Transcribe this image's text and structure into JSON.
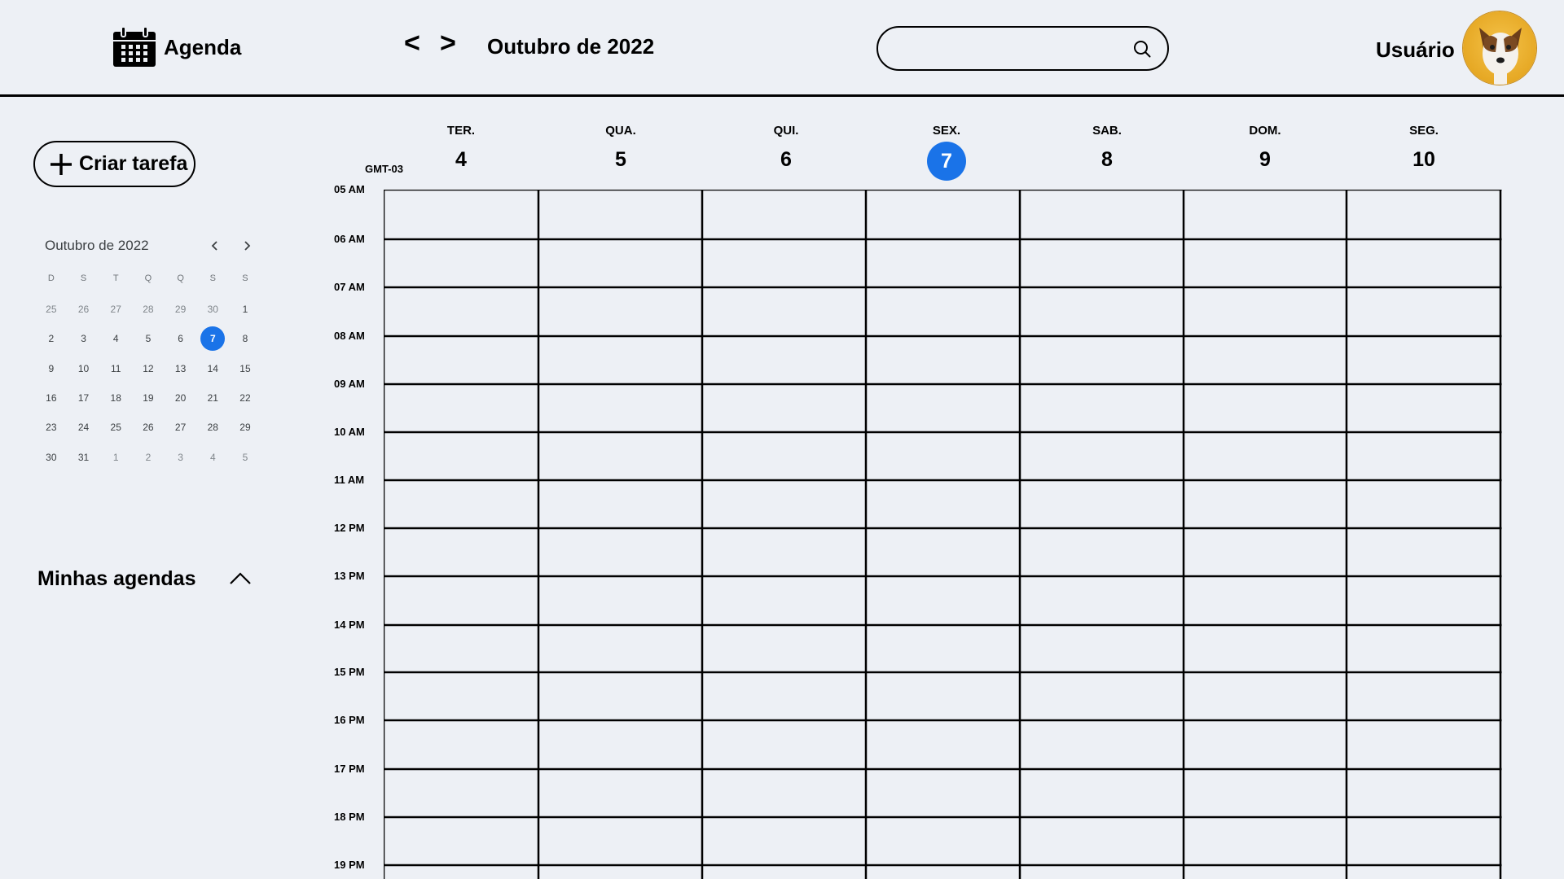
{
  "header": {
    "app_title": "Agenda",
    "prev_label": "<",
    "next_label": ">",
    "current_month": "Outubro de 2022",
    "search": {
      "value": "",
      "placeholder": ""
    },
    "user_name": "Usuário"
  },
  "sidebar": {
    "create_label": "Criar tarefa",
    "mini_calendar": {
      "title": "Outubro de 2022",
      "weekday_labels": [
        "D",
        "S",
        "T",
        "Q",
        "Q",
        "S",
        "S"
      ],
      "weeks": [
        [
          "25",
          "26",
          "27",
          "28",
          "29",
          "30",
          "1"
        ],
        [
          "2",
          "3",
          "4",
          "5",
          "6",
          "7",
          "8"
        ],
        [
          "9",
          "10",
          "11",
          "12",
          "13",
          "14",
          "15"
        ],
        [
          "16",
          "17",
          "18",
          "19",
          "20",
          "21",
          "22"
        ],
        [
          "23",
          "24",
          "25",
          "26",
          "27",
          "28",
          "29"
        ],
        [
          "30",
          "31",
          "1",
          "2",
          "3",
          "4",
          "5"
        ]
      ],
      "selected": "7"
    },
    "my_calendars_label": "Minhas agendas"
  },
  "week": {
    "timezone": "GMT-03",
    "days": [
      {
        "name": "TER.",
        "num": "4"
      },
      {
        "name": "QUA.",
        "num": "5"
      },
      {
        "name": "QUI.",
        "num": "6"
      },
      {
        "name": "SEX.",
        "num": "7"
      },
      {
        "name": "SAB.",
        "num": "8"
      },
      {
        "name": "DOM.",
        "num": "9"
      },
      {
        "name": "SEG.",
        "num": "10"
      }
    ],
    "today_index": 3,
    "hours": [
      "05 AM",
      "06 AM",
      "07 AM",
      "08 AM",
      "09 AM",
      "10 AM",
      "11 AM",
      "12 PM",
      "13 PM",
      "14 PM",
      "15 PM",
      "16 PM",
      "17 PM",
      "18 PM",
      "19 PM"
    ]
  },
  "colors": {
    "accent": "#1a73e8",
    "background": "#edf0f5",
    "line": "#000000"
  }
}
